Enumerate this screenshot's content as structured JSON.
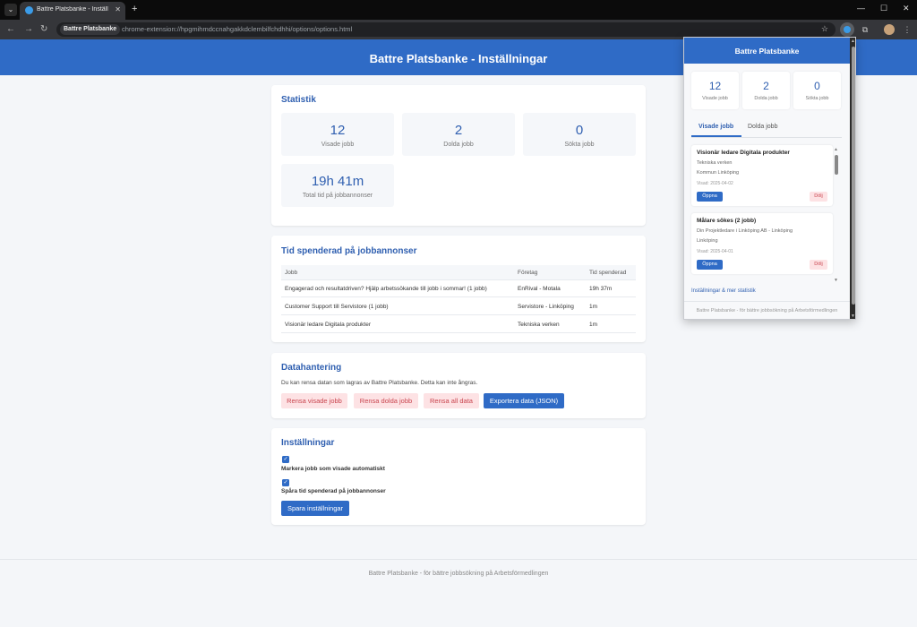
{
  "browser": {
    "tab_title": "Battre Platsbanke - Inställningar",
    "site_chip": "Battre Platsbanke",
    "url": "chrome-extension://hpgmihmdccnahgakkdclembilfchdhhi/options/options.html"
  },
  "page": {
    "title": "Battre Platsbanke - Inställningar",
    "footer": "Battre Platsbanke - för bättre jobbsökning på Arbetsförmedlingen"
  },
  "stats": {
    "title": "Statistik",
    "items": [
      {
        "value": "12",
        "label": "Visade jobb"
      },
      {
        "value": "2",
        "label": "Dolda jobb"
      },
      {
        "value": "0",
        "label": "Sökta jobb"
      },
      {
        "value": "19h 41m",
        "label": "Total tid på jobbannonser"
      }
    ]
  },
  "time_spent": {
    "title": "Tid spenderad på jobbannonser",
    "columns": [
      "Jobb",
      "Företag",
      "Tid spenderad"
    ],
    "rows": [
      [
        "Engagerad och resultatdriven? Hjälp arbetssökande till jobb i sommar! (1 jobb)",
        "EnRival - Motala",
        "19h 37m"
      ],
      [
        "Customer Support till Servistore (1 jobb)",
        "Servistore - Linköping",
        "1m"
      ],
      [
        "Visionär ledare Digitala produkter",
        "Tekniska verken",
        "1m"
      ]
    ]
  },
  "data_handling": {
    "title": "Datahantering",
    "description": "Du kan rensa datan som lagras av Battre Platsbanke. Detta kan inte ångras.",
    "buttons": {
      "clear_viewed": "Rensa visade jobb",
      "clear_hidden": "Rensa dolda jobb",
      "clear_all": "Rensa all data",
      "export": "Exportera data (JSON)"
    }
  },
  "settings": {
    "title": "Inställningar",
    "options": [
      {
        "label": "Markera jobb som visade automatiskt",
        "checked": true
      },
      {
        "label": "Spåra tid spenderad på jobbannonser",
        "checked": true
      }
    ],
    "save": "Spara inställningar"
  },
  "popup": {
    "title": "Battre Platsbanke",
    "stats": [
      {
        "value": "12",
        "label": "Visade jobb"
      },
      {
        "value": "2",
        "label": "Dolda jobb"
      },
      {
        "value": "0",
        "label": "Sökta jobb"
      }
    ],
    "tabs": [
      "Visade jobb",
      "Dolda jobb"
    ],
    "jobs": [
      {
        "title": "Visionär ledare Digitala produkter",
        "company": "Tekniska verken",
        "location": "Kommun Linköping",
        "date": "Visad: 2025-04-02",
        "open": "Öppna",
        "hide": "Dölj"
      },
      {
        "title": "Målare sökes (2 jobb)",
        "company": "Din Projektledare i Linköping AB - Linköping",
        "location": "Linköping",
        "date": "Visad: 2025-04-01",
        "open": "Öppna",
        "hide": "Dölj"
      }
    ],
    "settings_link": "Inställningar & mer statistik",
    "footer": "Battre Platsbanke - för bättre jobbsökning på Arbetsförmedlingen"
  },
  "colors": {
    "primary": "#2f6bc6",
    "accent_text": "#2f5fb0",
    "danger_bg": "#fde2e4",
    "danger_text": "#c9444e",
    "page_bg": "#f4f6f9"
  }
}
